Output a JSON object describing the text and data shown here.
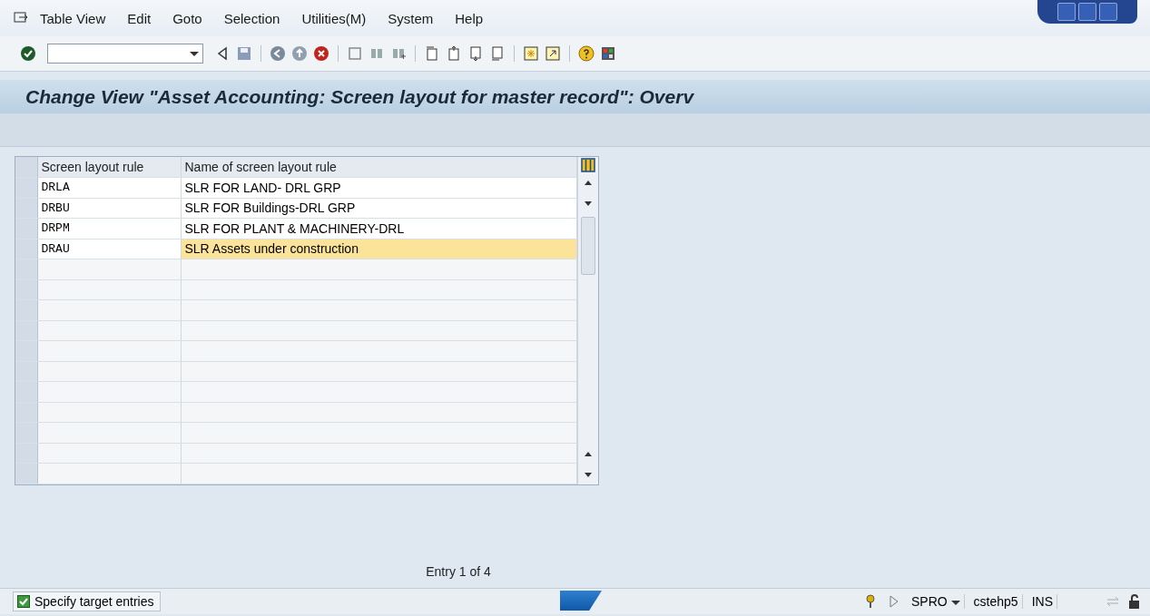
{
  "menu_bar": {
    "items": [
      "Table View",
      "Edit",
      "Goto",
      "Selection",
      "Utilities(M)",
      "System",
      "Help"
    ]
  },
  "title": "Change View \"Asset Accounting: Screen layout for master record\": Overv",
  "table": {
    "columns": [
      "Screen layout rule",
      "Name of screen layout rule"
    ],
    "rows": [
      {
        "rule": "DRLA",
        "name": "SLR FOR LAND- DRL GRP",
        "focused": false
      },
      {
        "rule": "DRBU",
        "name": "SLR FOR Buildings-DRL GRP",
        "focused": false
      },
      {
        "rule": "DRPM",
        "name": "SLR FOR PLANT & MACHINERY-DRL",
        "focused": false
      },
      {
        "rule": "DRAU",
        "name": "SLR Assets under construction",
        "focused": true
      }
    ]
  },
  "entry_info": "Entry 1 of 4",
  "status_bar": {
    "message": "Specify target entries",
    "transaction": "SPRO",
    "server": "cstehp5",
    "mode": "INS"
  }
}
